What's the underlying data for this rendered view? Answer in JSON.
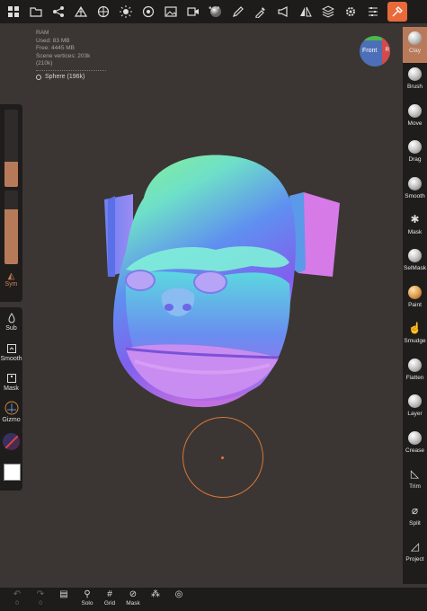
{
  "stats": {
    "ram": "RAM",
    "used": "Used: 83 MB",
    "free": "Free: 4445 MB",
    "vertices": "Scene vertices: 203k (210k)"
  },
  "scene": {
    "object_label": "Sphere (196k)"
  },
  "gizmo": {
    "front": "Front",
    "right": "R"
  },
  "left": {
    "sym": "Sym",
    "sub": "Sub",
    "smooth": "Smooth",
    "mask": "Mask",
    "gizmo": "Gizmo"
  },
  "tools": [
    {
      "label": "Clay"
    },
    {
      "label": "Brush"
    },
    {
      "label": "Move"
    },
    {
      "label": "Drag"
    },
    {
      "label": "Smooth"
    },
    {
      "label": "Mask"
    },
    {
      "label": "SelMask"
    },
    {
      "label": "Paint"
    },
    {
      "label": "Smudge"
    },
    {
      "label": "Flatten"
    },
    {
      "label": "Layer"
    },
    {
      "label": "Crease"
    },
    {
      "label": "Trim"
    },
    {
      "label": "Split"
    },
    {
      "label": "Project"
    }
  ],
  "bottom": {
    "undo_count": "0",
    "redo_count": "0",
    "solo": "Solo",
    "grid": "Grid",
    "mask": "Mask"
  },
  "colors": {
    "accent": "#e86a3a",
    "active_tool": "#b97a5a",
    "background": "#3b3633"
  }
}
